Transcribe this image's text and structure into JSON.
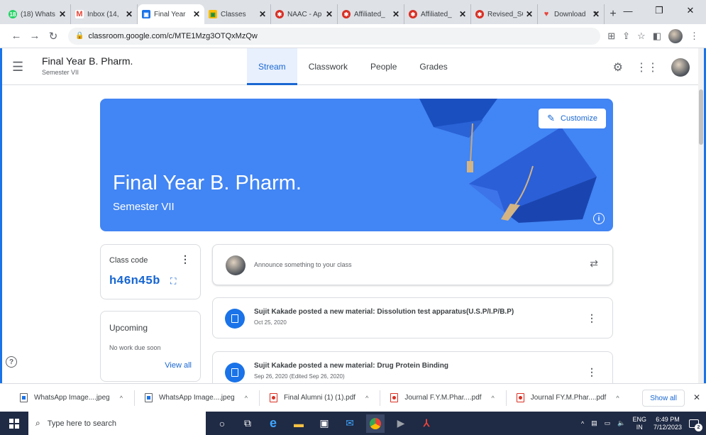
{
  "browser": {
    "tabs": [
      {
        "title": "(18) Whats",
        "fav_color": "#25d366",
        "fav_glyph": "18",
        "active": false
      },
      {
        "title": "Inbox (14,",
        "fav_color": "#ea4335",
        "fav_glyph": "M",
        "active": false
      },
      {
        "title": "Final Year",
        "fav_color": "#1a73e8",
        "fav_glyph": "▣",
        "active": true
      },
      {
        "title": "Classes",
        "fav_color": "#fbbc04",
        "fav_glyph": "▣",
        "active": false
      },
      {
        "title": "NAAC - Ap",
        "fav_color": "#d93025",
        "fav_glyph": "✱",
        "active": false
      },
      {
        "title": "Affiliated_",
        "fav_color": "#d93025",
        "fav_glyph": "✱",
        "active": false
      },
      {
        "title": "Affiliated_",
        "fav_color": "#d93025",
        "fav_glyph": "✱",
        "active": false
      },
      {
        "title": "Revised_SC",
        "fav_color": "#d93025",
        "fav_glyph": "✱",
        "active": false
      },
      {
        "title": "Download",
        "fav_color": "#e8453c",
        "fav_glyph": "♥",
        "active": false
      }
    ],
    "new_tab": "+",
    "url": "classroom.google.com/c/MTE1Mzg3OTQxMzQw"
  },
  "classroom": {
    "class_name": "Final Year B. Pharm.",
    "section": "Semester VII",
    "tabs": [
      "Stream",
      "Classwork",
      "People",
      "Grades"
    ],
    "active_tab": "Stream",
    "banner": {
      "title": "Final Year B. Pharm.",
      "subtitle": "Semester VII",
      "customize_label": "Customize",
      "color": "#4285f4"
    },
    "class_code": {
      "label": "Class code",
      "code": "h46n45b"
    },
    "upcoming": {
      "title": "Upcoming",
      "empty": "No work due soon",
      "view_all": "View all"
    },
    "announce_placeholder": "Announce something to your class",
    "posts": [
      {
        "title": "Sujit Kakade posted a new material: Dissolution test apparatus(U.S.P/I.P/B.P)",
        "date": "Oct 25, 2020"
      },
      {
        "title": "Sujit Kakade posted a new material: Drug Protein Binding",
        "date": "Sep 26, 2020 (Edited Sep 26, 2020)"
      }
    ]
  },
  "downloads": {
    "items": [
      {
        "name": "WhatsApp Image....jpeg",
        "kind": "img"
      },
      {
        "name": "WhatsApp Image....jpeg",
        "kind": "img"
      },
      {
        "name": "Final Alumni (1) (1).pdf",
        "kind": "pdf"
      },
      {
        "name": "Journal F.Y.M.Phar....pdf",
        "kind": "pdf"
      },
      {
        "name": "Journal FY.M.Phar....pdf",
        "kind": "pdf"
      }
    ],
    "show_all": "Show all"
  },
  "taskbar": {
    "search_placeholder": "Type here to search",
    "lang_top": "ENG",
    "lang_bottom": "IN",
    "time": "6:49 PM",
    "date": "7/12/2023",
    "notif_count": "2"
  },
  "colors": {
    "accent": "#1967d2",
    "banner": "#4285f4",
    "taskbar": "#1f2a44"
  }
}
